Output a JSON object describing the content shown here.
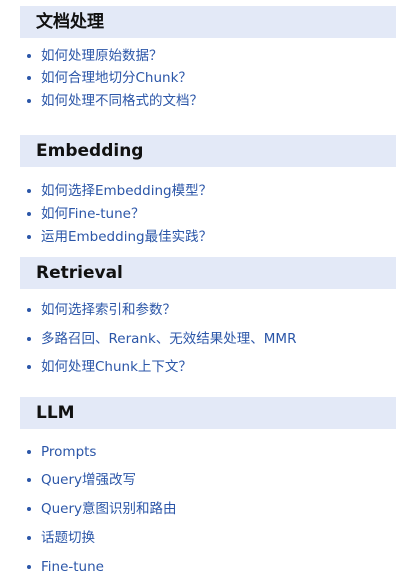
{
  "sections": [
    {
      "title": "文档处理",
      "items": [
        "如何处理原始数据？",
        "如何合理地切分Chunk？",
        "如何处理不同格式的文档？"
      ]
    },
    {
      "title": "Embedding",
      "items": [
        "如何选择Embedding模型？",
        "如何Fine-tune？",
        "运用Embedding最佳实践？"
      ]
    },
    {
      "title": "Retrieval",
      "items": [
        "如何选择索引和参数？",
        "多路召回、Rerank、无效结果处理、MMR",
        "如何处理Chunk上下文？"
      ]
    },
    {
      "title": "LLM",
      "items": [
        "Prompts",
        "Query增强改写",
        "Query意图识别和路由",
        "话题切换",
        "Fine-tune"
      ]
    }
  ]
}
